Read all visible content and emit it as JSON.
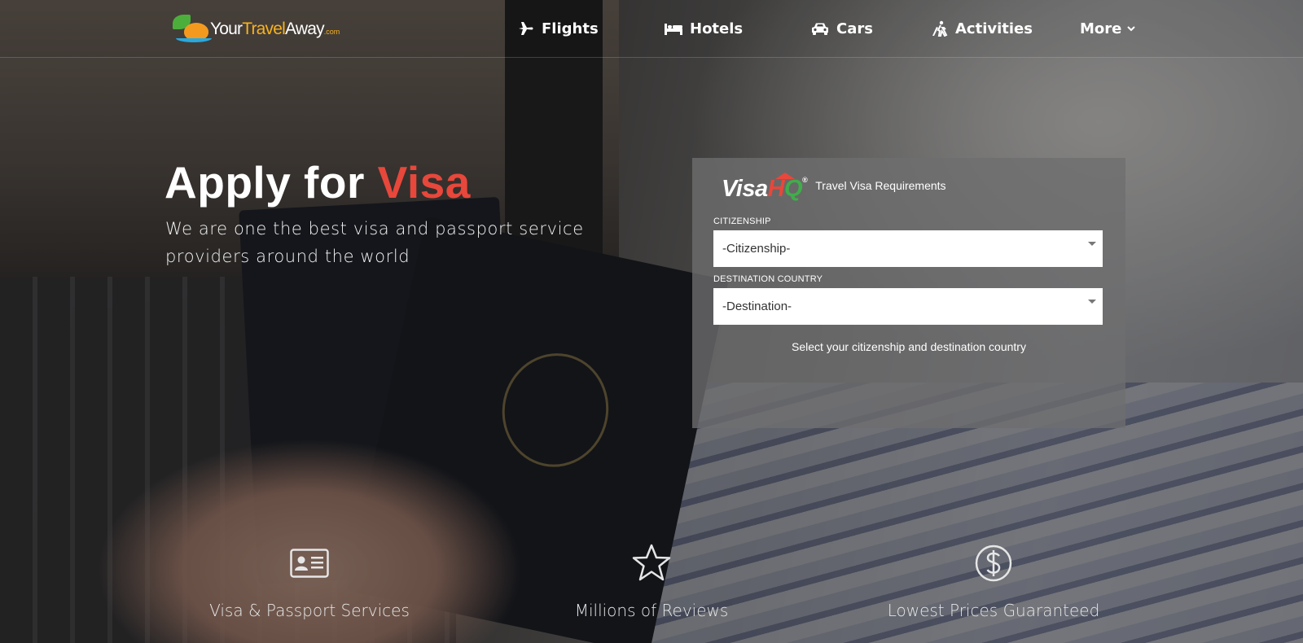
{
  "brand": {
    "logo_main": "Your",
    "logo_accent": "Travel",
    "logo_end": "Away",
    "logo_domain": ".com"
  },
  "nav": {
    "items": [
      {
        "label": "Flights",
        "icon": "airplane-icon"
      },
      {
        "label": "Hotels",
        "icon": "bed-icon"
      },
      {
        "label": "Cars",
        "icon": "car-icon"
      },
      {
        "label": "Activities",
        "icon": "hiker-icon"
      },
      {
        "label": "More",
        "icon": "chevron-down-icon"
      }
    ]
  },
  "hero": {
    "title_main": "Apply for ",
    "title_accent": "Visa",
    "subtitle": "We are one the best visa and passport service providers around the world"
  },
  "visa_panel": {
    "logo_main": "Visa",
    "logo_h": "H",
    "logo_q": "Q",
    "logo_reg": "®",
    "heading": "Travel Visa Requirements",
    "citizenship_label": "CITIZENSHIP",
    "citizenship_value": "-Citizenship-",
    "destination_label": "DESTINATION COUNTRY",
    "destination_value": "-Destination-",
    "help_text": "Select your citizenship and destination country"
  },
  "features": [
    {
      "label": "Visa & Passport Services",
      "icon": "id-card-icon"
    },
    {
      "label": "Millions of Reviews",
      "icon": "star-icon"
    },
    {
      "label": "Lowest Prices Guaranteed",
      "icon": "dollar-circle-icon"
    }
  ],
  "colors": {
    "accent_red": "#e8473b",
    "logo_orange": "#f7b21f",
    "logo_green": "#3fae49"
  }
}
